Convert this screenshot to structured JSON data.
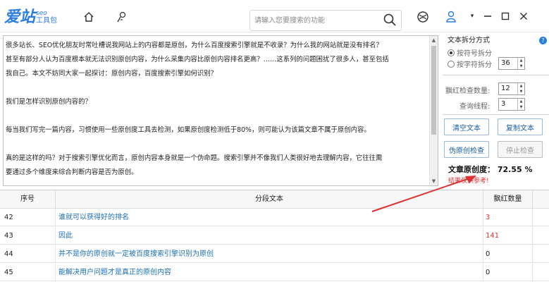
{
  "app": {
    "logo_main": "爱站",
    "logo_seo": "seo",
    "logo_tool": "工具包"
  },
  "search": {
    "placeholder": "请输入您要搜索的功能"
  },
  "editor": {
    "lines": [
      "很多站长、SEO优化朋友时常吐槽说我网站上的内容都是原创，为什么百度搜索引擎就是不收录？为什么我的网站就是没有排名？",
      "甚至有部分人认为百度根本就无法识别原创内容，为什么采集内容比原创内容排名更高？……这系列的问题困扰了很多人，甚至包括",
      "我自己。本文不妨同大家一起探讨：原创内容，百度搜索引擎如何识别？",
      "",
      "我们是怎样识别原创内容的？",
      "",
      "每当我们写完一篇内容，习惯使用一些原创度工具去检测，如果原创度检测低于80%，则可能认为该篇文章不属于原创内容。",
      "",
      "真的是这样的吗？对于搜索引擎优化而言，原创内容本身就是一个伪命题。搜索引擎并不像我们人类很好地去理解内容，它往往需",
      "要通过多个维度来综合判断内容是否为原创。"
    ]
  },
  "panel": {
    "split_title": "文本拆分方式",
    "radio_symbol": "按符号拆分",
    "radio_char": "按字符拆分",
    "char_count": "36",
    "red_check_label": "飘红检查数量:",
    "red_check_value": "12",
    "threads_label": "查询线程:",
    "threads_value": "3",
    "btn_clear": "清空文本",
    "btn_copy": "复制文本",
    "btn_check": "伪原创检查",
    "btn_stop": "停止检查",
    "degree_text": "文章原创度： 72.55 %",
    "note_text": "结果仅供参考!"
  },
  "table": {
    "headers": [
      "序号",
      "分段文本",
      "飘红数量"
    ],
    "rows": [
      {
        "idx": "42",
        "text": "谁就可以获得好的排名",
        "count": "3",
        "count_red": true
      },
      {
        "idx": "43",
        "text": "因此",
        "count": "141",
        "count_red": true
      },
      {
        "idx": "44",
        "text": "并不是你的原创就一定被百度搜索引擎识别为原创",
        "count": "0",
        "count_red": false
      },
      {
        "idx": "45",
        "text": "能解决用户问题才是真正的原创内容",
        "count": "0",
        "count_red": false
      }
    ]
  },
  "colors": {
    "accent": "#2a7de1",
    "link": "#1a6fb5",
    "alert": "#e03030"
  }
}
